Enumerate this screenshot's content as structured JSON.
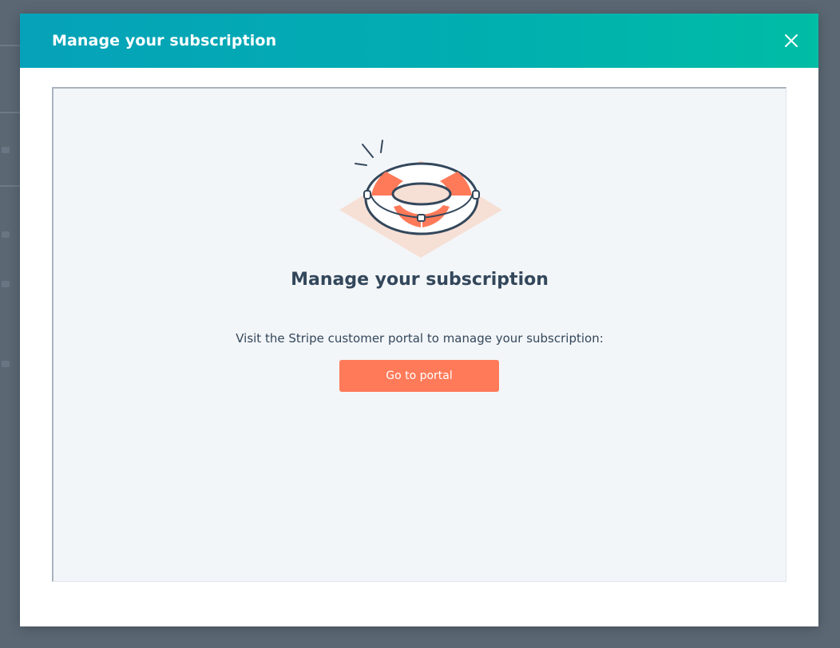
{
  "modal": {
    "title": "Manage your subscription",
    "close_icon": "close-icon"
  },
  "content": {
    "illustration_icon": "life-ring-icon",
    "heading": "Manage your subscription",
    "description": "Visit the Stripe customer portal to manage your subscription:",
    "button_label": "Go to portal"
  },
  "colors": {
    "header_gradient_start": "#06a2b9",
    "header_gradient_end": "#00bda5",
    "button": "#ff7a59",
    "text": "#33475b",
    "panel_background": "#f3f6f9",
    "overlay": "#5b6874"
  }
}
